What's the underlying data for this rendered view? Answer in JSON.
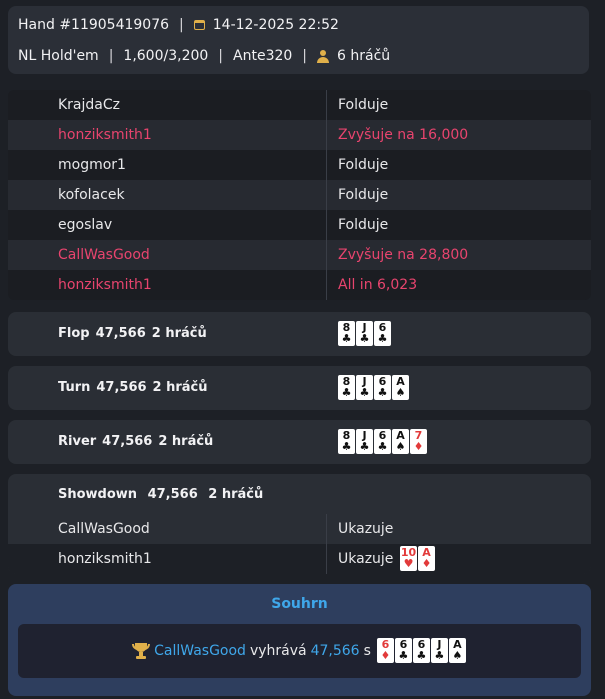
{
  "header": {
    "hand_id": "Hand #11905419076",
    "datetime": "14-12-2025 22:52",
    "game": "NL Hold'em",
    "stakes": "1,600/3,200",
    "ante": "Ante320",
    "players": "6 hráčů",
    "separator": "|"
  },
  "actions": [
    {
      "player": "KrajdaCz",
      "action": "Folduje",
      "highlight": false
    },
    {
      "player": "honziksmith1",
      "action": "Zvyšuje na 16,000",
      "highlight": true
    },
    {
      "player": "mogmor1",
      "action": "Folduje",
      "highlight": false
    },
    {
      "player": "kofolacek",
      "action": "Folduje",
      "highlight": false
    },
    {
      "player": "egoslav",
      "action": "Folduje",
      "highlight": false
    },
    {
      "player": "CallWasGood",
      "action": "Zvyšuje na 28,800",
      "highlight": true
    },
    {
      "player": "honziksmith1",
      "action": "All in 6,023",
      "highlight": true
    }
  ],
  "streets": [
    {
      "name": "Flop",
      "pot": "47,566",
      "players": "2 hráčů",
      "cards": [
        {
          "rank": "8",
          "suit": "♣",
          "color": "black"
        },
        {
          "rank": "J",
          "suit": "♣",
          "color": "black"
        },
        {
          "rank": "6",
          "suit": "♣",
          "color": "black"
        }
      ]
    },
    {
      "name": "Turn",
      "pot": "47,566",
      "players": "2 hráčů",
      "cards": [
        {
          "rank": "8",
          "suit": "♣",
          "color": "black"
        },
        {
          "rank": "J",
          "suit": "♣",
          "color": "black"
        },
        {
          "rank": "6",
          "suit": "♣",
          "color": "black"
        },
        {
          "rank": "A",
          "suit": "♠",
          "color": "black"
        }
      ]
    },
    {
      "name": "River",
      "pot": "47,566",
      "players": "2 hráčů",
      "cards": [
        {
          "rank": "8",
          "suit": "♣",
          "color": "black"
        },
        {
          "rank": "J",
          "suit": "♣",
          "color": "black"
        },
        {
          "rank": "6",
          "suit": "♣",
          "color": "black"
        },
        {
          "rank": "A",
          "suit": "♠",
          "color": "black"
        },
        {
          "rank": "7",
          "suit": "♦",
          "color": "red"
        }
      ]
    }
  ],
  "showdown": {
    "name": "Showdown",
    "pot": "47,566",
    "players": "2 hráčů",
    "rows": [
      {
        "player": "CallWasGood",
        "action": "Ukazuje",
        "cards": []
      },
      {
        "player": "honziksmith1",
        "action": "Ukazuje",
        "cards": [
          {
            "rank": "10",
            "suit": "♥",
            "color": "red"
          },
          {
            "rank": "A",
            "suit": "♦",
            "color": "red"
          }
        ]
      }
    ]
  },
  "summary": {
    "title": "Souhrn",
    "winner": "CallWasGood",
    "verb": "vyhrává",
    "amount": "47,566",
    "with": "s",
    "cards": [
      {
        "rank": "6",
        "suit": "♦",
        "color": "red"
      },
      {
        "rank": "6",
        "suit": "♣",
        "color": "black"
      },
      {
        "rank": "6",
        "suit": "♣",
        "color": "black"
      },
      {
        "rank": "J",
        "suit": "♣",
        "color": "black"
      },
      {
        "rank": "A",
        "suit": "♠",
        "color": "black"
      }
    ]
  },
  "icons": {
    "calendar": "calendar-icon",
    "user": "user-icon",
    "trophy": "trophy-icon"
  },
  "colors": {
    "highlight": "#e8446e",
    "accent": "#3fa7ea",
    "gold": "#e0b04a"
  }
}
